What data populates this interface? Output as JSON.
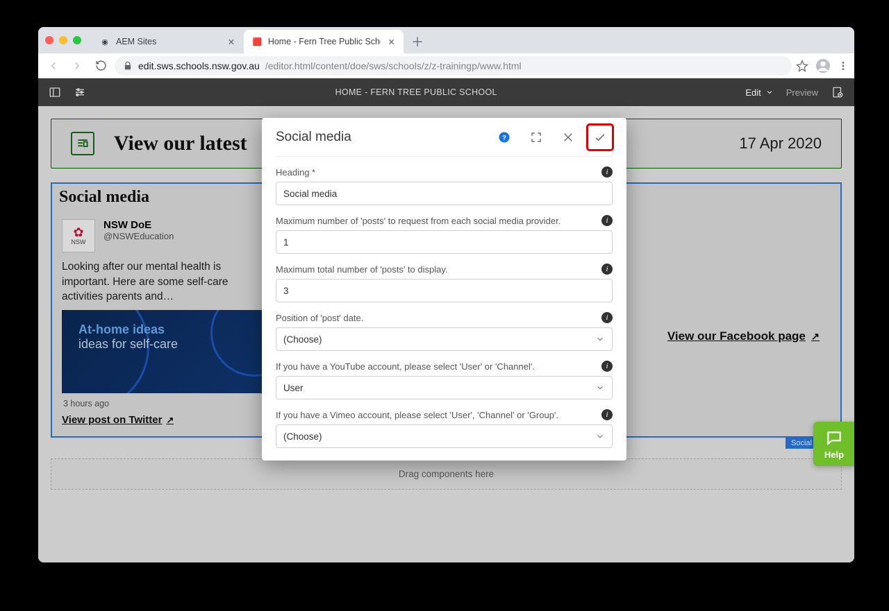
{
  "browser": {
    "tabs": [
      {
        "label": "AEM Sites",
        "active": false,
        "favicon": "◉"
      },
      {
        "label": "Home - Fern Tree Public Schoo",
        "active": true,
        "favicon": "🟥"
      }
    ],
    "url_host": "edit.sws.schools.nsw.gov.au",
    "url_path": "/editor.html/content/doe/sws/schools/z/z-trainingp/www.html"
  },
  "aem": {
    "title": "HOME - FERN TREE PUBLIC SCHOOL",
    "mode": "Edit",
    "preview": "Preview"
  },
  "news": {
    "title": "View our latest",
    "date": "17 Apr 2020"
  },
  "component": {
    "label": "Social media",
    "heading": "Social media",
    "post": {
      "author": "NSW DoE",
      "handle": "@NSWEducation",
      "avatar_caption": "NSW",
      "body": "Looking after our mental health is important. Here are some self-care activities parents and…",
      "img_line1": "At-home ideas",
      "img_line2": "ideas for self-care",
      "time": "3 hours ago",
      "link": "View post on Twitter"
    },
    "fb_link": "View our Facebook page"
  },
  "dropzone": "Drag components here",
  "modal": {
    "title": "Social media",
    "fields": {
      "heading": {
        "label": "Heading *",
        "value": "Social media"
      },
      "max_per": {
        "label": "Maximum number of 'posts' to request from each social media provider.",
        "value": "1"
      },
      "max_total": {
        "label": "Maximum total number of 'posts' to display.",
        "value": "3"
      },
      "pos_date": {
        "label": "Position of 'post' date.",
        "value": "(Choose)"
      },
      "youtube": {
        "label": "If you have a YouTube account, please select 'User' or 'Channel'.",
        "value": "User"
      },
      "vimeo": {
        "label": "If you have a Vimeo account, please select 'User', 'Channel' or 'Group'.",
        "value": "(Choose)"
      }
    }
  },
  "help": "Help"
}
